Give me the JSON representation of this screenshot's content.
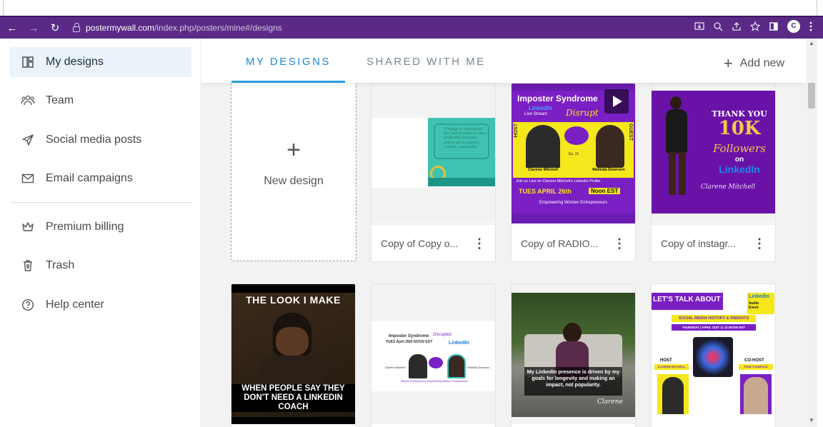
{
  "browser": {
    "url_domain": "postermywall.com",
    "url_path": "/index.php/posters/mine#/designs",
    "back_icon": "←",
    "forward_icon": "→",
    "reload_icon": "↻",
    "profile_initial": "C"
  },
  "sidebar": {
    "items": [
      {
        "label": "My designs",
        "icon": "layout-icon"
      },
      {
        "label": "Team",
        "icon": "team-icon"
      },
      {
        "label": "Social media posts",
        "icon": "send-icon"
      },
      {
        "label": "Email campaigns",
        "icon": "mail-icon"
      },
      {
        "label": "Premium billing",
        "icon": "crown-icon"
      },
      {
        "label": "Trash",
        "icon": "trash-icon"
      },
      {
        "label": "Help center",
        "icon": "help-icon"
      }
    ]
  },
  "tabs": [
    {
      "label": "MY DESIGNS",
      "active": true
    },
    {
      "label": "SHARED WITH ME",
      "active": false
    }
  ],
  "add_new_label": "Add new",
  "new_design": {
    "plus": "+",
    "label": "New design"
  },
  "cards": [
    {
      "title": "Copy of Copy o...",
      "quote": "\"Change is not always fun, but in order to run a profitable business, you've got to assess, correct, constantly.\""
    },
    {
      "title": "Copy of RADIO...",
      "header": "Imposter Syndrome",
      "sub1": "LinkedIn",
      "sub2": "Live Stream",
      "script": "Disrupt",
      "host": "HOST",
      "guest": "GUEST",
      "ep": "Ep. 31",
      "name1": "Clarene Mitchell",
      "role1": "LinkedIn Coach & Trainer",
      "name2": "Melinda Emerson",
      "role2": "Small Biz Lady",
      "join": "Join us Live on Clarene Mitchell's LinkedIn Profile",
      "date": "TUES APRIL 26th",
      "time": "Noon EST",
      "footer": "Empowering Women Entrepreneurs"
    },
    {
      "title": "Copy of instagr...",
      "thank": "THANK YOU",
      "big": "10K",
      "followers": "Followers",
      "on": "on",
      "linkedin": "LinkedIn",
      "sig": "Clarene Mitchell"
    }
  ],
  "row2": [
    {
      "top": "THE LOOK I MAKE",
      "bottom": "WHEN PEOPLE SAY THEY DON'T NEED A LINKEDIN COACH"
    },
    {
      "head": "Imposter Syndrome",
      "head2": "Disrupted",
      "line2": "TUES April 26th NOON EDT",
      "li": "LinkedIn",
      "host": "Clarene Mitchell",
      "guest": "Melinda Emerson",
      "foot": "Women Entrepreneurs Empowering Women Entrepreneurs"
    },
    {
      "caption": "My LinkedIn presence is driven by my goals for longevity and making an impact, not popularity.",
      "sig": "Clarene"
    },
    {
      "title": "LET'S TALK ABOUT IT",
      "li": "LinkedIn",
      "audio": "Audio Event",
      "band": "SOCIAL MEDIA HISTORY & INSIGHTS",
      "date": "THURSDAY | APRIL 21ST @ 12 NOON EDT",
      "host": "HOST",
      "host_name": "CLARENE MITCHELL",
      "cohost": "CO-HOST",
      "cohost_name": "RYAN THOMPSON"
    }
  ]
}
